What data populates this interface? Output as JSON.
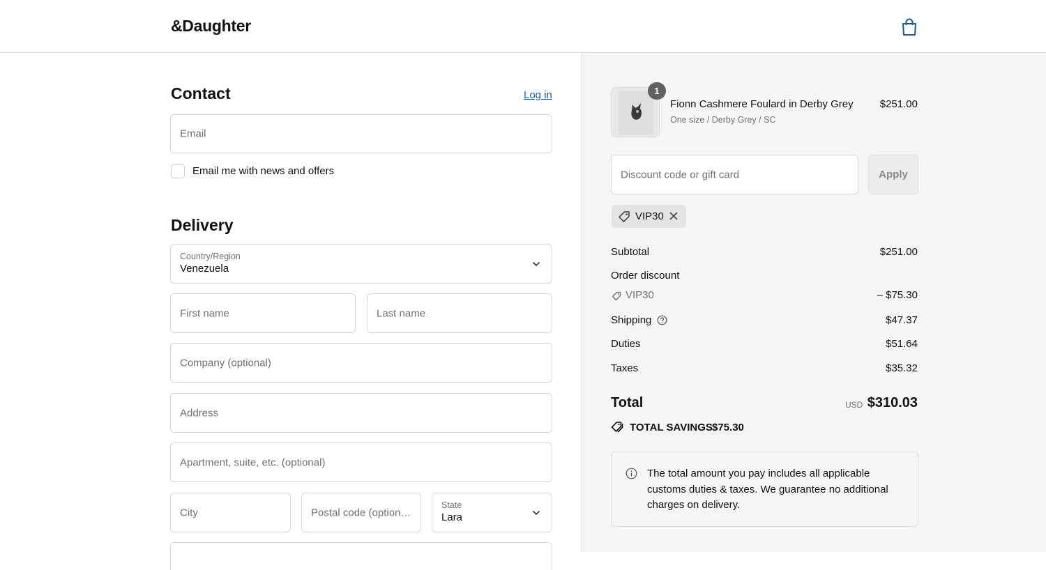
{
  "header": {
    "logo": "&Daughter",
    "cart_icon": "shopping-bag-icon"
  },
  "contact": {
    "title": "Contact",
    "login_label": "Log in",
    "email_placeholder": "Email",
    "newsletter_label": "Email me with news and offers",
    "newsletter_checked": false
  },
  "delivery": {
    "title": "Delivery",
    "country_label": "Country/Region",
    "country_value": "Venezuela",
    "first_name_placeholder": "First name",
    "last_name_placeholder": "Last name",
    "company_placeholder": "Company (optional)",
    "address_placeholder": "Address",
    "apartment_placeholder": "Apartment, suite, etc. (optional)",
    "city_placeholder": "City",
    "postal_placeholder": "Postal code (option…",
    "state_label": "State",
    "state_value": "Lara"
  },
  "order": {
    "item": {
      "quantity": "1",
      "name": "Fionn Cashmere Foulard in Derby Grey",
      "variant": "One size / Derby Grey / SC",
      "price": "$251.00"
    },
    "discount_placeholder": "Discount code or gift card",
    "apply_label": "Apply",
    "applied_code": "VIP30",
    "subtotal_label": "Subtotal",
    "subtotal_value": "$251.00",
    "order_discount_label": "Order discount",
    "discount_code": "VIP30",
    "discount_value": "– $75.30",
    "shipping_label": "Shipping",
    "shipping_value": "$47.37",
    "duties_label": "Duties",
    "duties_value": "$51.64",
    "taxes_label": "Taxes",
    "taxes_value": "$35.32",
    "total_label": "Total",
    "total_currency": "USD",
    "total_value": "$310.03",
    "savings_label": "TOTAL SAVINGS",
    "savings_value": "$75.30",
    "info_text": "The total amount you pay includes all applicable customs duties & taxes. We guarantee no additional charges on delivery."
  },
  "colors": {
    "link": "#1f5a8f",
    "summary_bg": "#f5f5f5",
    "badge": "#616161"
  }
}
